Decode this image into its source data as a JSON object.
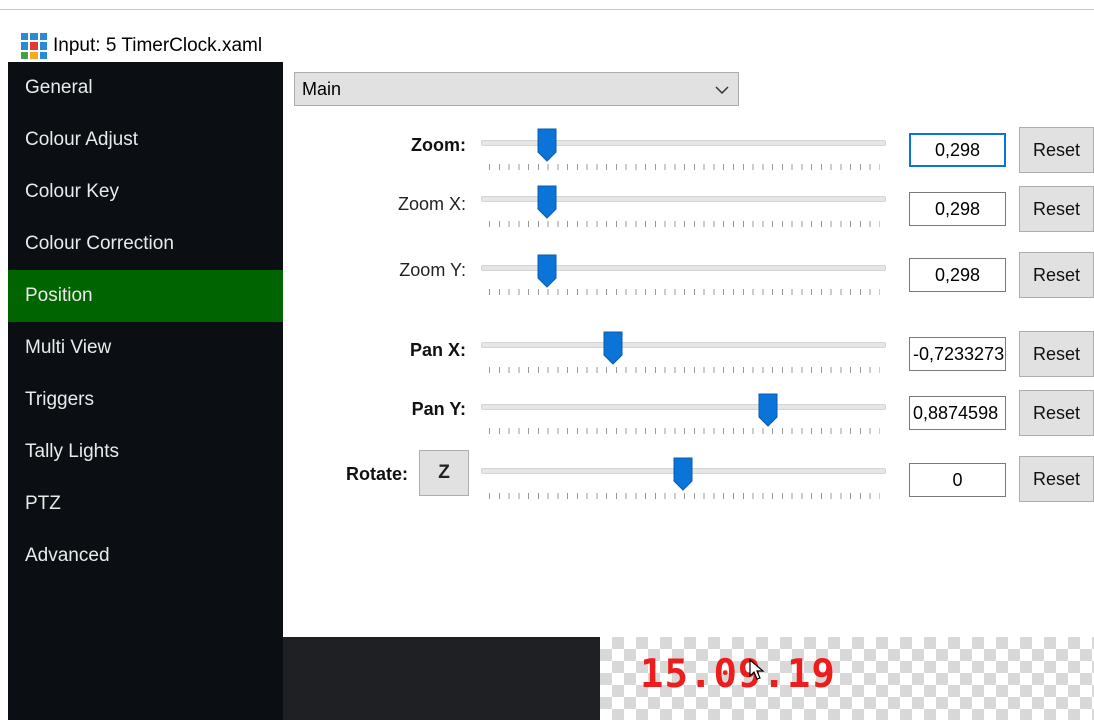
{
  "window": {
    "title": "Input: 5 TimerClock.xaml"
  },
  "sidebar": {
    "items": [
      {
        "label": "General"
      },
      {
        "label": "Colour Adjust"
      },
      {
        "label": "Colour Key"
      },
      {
        "label": "Colour Correction"
      },
      {
        "label": "Position",
        "active": true
      },
      {
        "label": "Multi View"
      },
      {
        "label": "Triggers"
      },
      {
        "label": "Tally Lights"
      },
      {
        "label": "PTZ"
      },
      {
        "label": "Advanced"
      }
    ]
  },
  "layer_select": {
    "value": "Main"
  },
  "controls": {
    "zoom": {
      "label": "Zoom:",
      "value": "0,298",
      "reset": "Reset"
    },
    "zoom_x": {
      "label": "Zoom X:",
      "value": "0,298",
      "reset": "Reset"
    },
    "zoom_y": {
      "label": "Zoom Y:",
      "value": "0,298",
      "reset": "Reset"
    },
    "pan_x": {
      "label": "Pan X:",
      "value": "-0,7233273",
      "reset": "Reset"
    },
    "pan_y": {
      "label": "Pan Y:",
      "value": "0,8874598",
      "reset": "Reset"
    },
    "rotate": {
      "label": "Rotate:",
      "button": "Z",
      "value": "0",
      "reset": "Reset"
    }
  },
  "preview": {
    "clock_text": "15.09.19"
  },
  "colors": {
    "sidebar_bg": "#0b0f13",
    "active_item": "#006400",
    "slider_thumb": "#0a74d8",
    "clock_red": "#ee1c1c"
  }
}
